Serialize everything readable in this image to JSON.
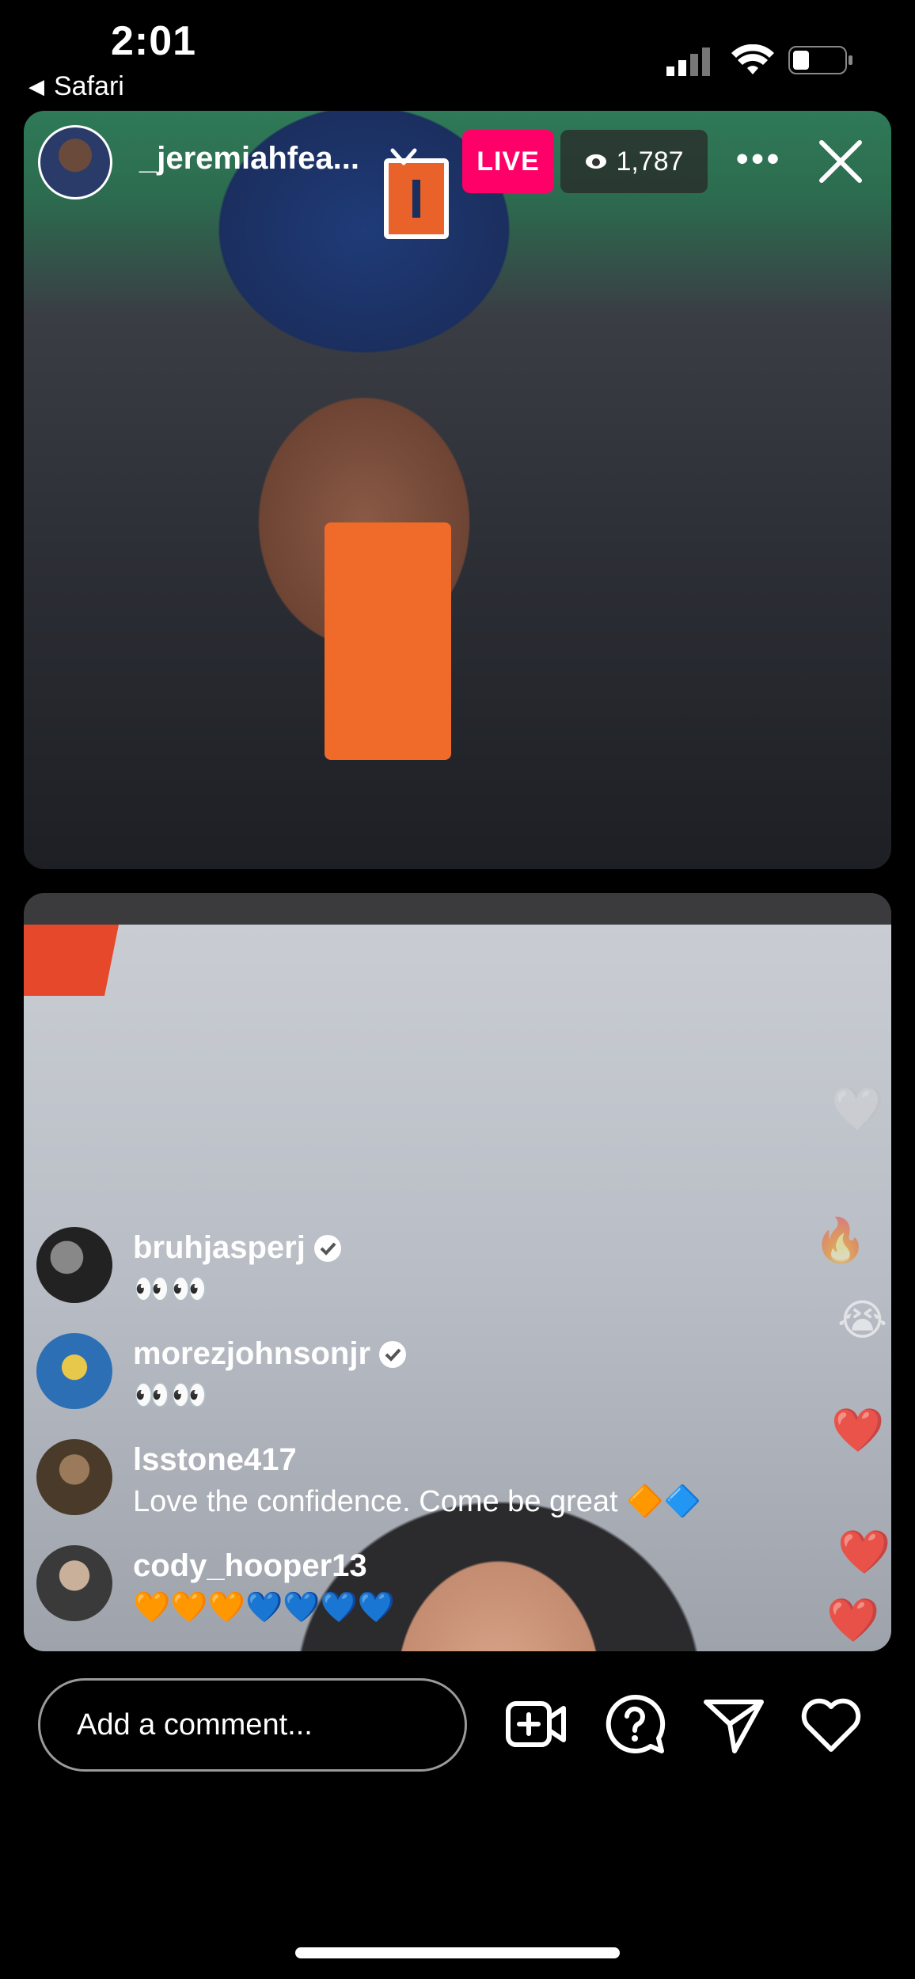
{
  "status_bar": {
    "time": "2:01",
    "back_app": "Safari"
  },
  "live": {
    "host_username": "_jeremiahfea...",
    "live_label": "LIVE",
    "viewer_count": "1,787"
  },
  "comments": [
    {
      "username": "bruhjasperj",
      "verified": true,
      "text": "👀👀"
    },
    {
      "username": "morezjohnsonjr",
      "verified": true,
      "text": "👀👀"
    },
    {
      "username": "lsstone417",
      "verified": false,
      "text": "Love the confidence. Come be great 🔶🔷"
    },
    {
      "username": "cody_hooper13",
      "verified": false,
      "text": "🧡🧡🧡💙💙💙💙"
    }
  ],
  "comment_box": {
    "placeholder": "Add a comment..."
  },
  "icons": {
    "host_avatar": "avatar",
    "dropdown": "chevron-down-icon",
    "viewers": "eye-icon",
    "more": "more-icon",
    "close": "close-icon",
    "add_video": "add-video-icon",
    "question": "question-icon",
    "share": "send-icon",
    "like": "heart-icon"
  },
  "colors": {
    "live_badge": "#ff0069",
    "verified": "#3897f0"
  }
}
